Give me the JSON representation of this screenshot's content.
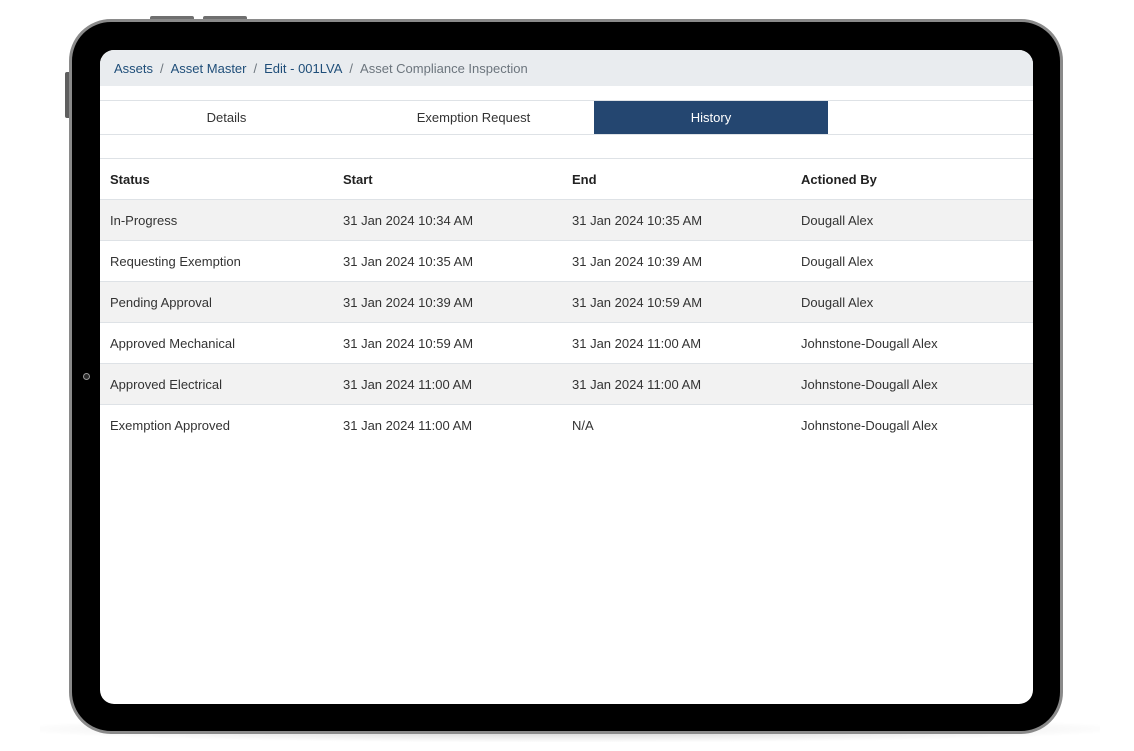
{
  "breadcrumb": {
    "items": [
      "Assets",
      "Asset Master",
      "Edit - 001LVA",
      "Asset Compliance Inspection"
    ],
    "separator": "/"
  },
  "tabs": [
    {
      "label": "Details",
      "active": false
    },
    {
      "label": "Exemption Request",
      "active": false
    },
    {
      "label": "History",
      "active": true
    }
  ],
  "table": {
    "columns": [
      "Status",
      "Start",
      "End",
      "Actioned By"
    ],
    "rows": [
      [
        "In-Progress",
        "31 Jan 2024 10:34 AM",
        "31 Jan 2024 10:35 AM",
        "Dougall Alex"
      ],
      [
        "Requesting Exemption",
        "31 Jan 2024 10:35 AM",
        "31 Jan 2024 10:39 AM",
        "Dougall Alex"
      ],
      [
        "Pending Approval",
        "31 Jan 2024 10:39 AM",
        "31 Jan 2024 10:59 AM",
        "Dougall Alex"
      ],
      [
        "Approved Mechanical",
        "31 Jan 2024 10:59 AM",
        "31 Jan 2024 11:00 AM",
        "Johnstone-Dougall Alex"
      ],
      [
        "Approved Electrical",
        "31 Jan 2024 11:00 AM",
        "31 Jan 2024 11:00 AM",
        "Johnstone-Dougall Alex"
      ],
      [
        "Exemption Approved",
        "31 Jan 2024 11:00 AM",
        "N/A",
        "Johnstone-Dougall Alex"
      ]
    ]
  },
  "colors": {
    "active_tab": "#244670",
    "breadcrumb_bg": "#e9ecef",
    "stripe": "#f2f2f2",
    "link": "#1f4e79"
  }
}
